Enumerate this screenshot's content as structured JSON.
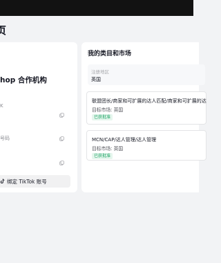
{
  "page": {
    "title": "页"
  },
  "org": {
    "name": "hop 合作机构",
    "field_label_1": "K",
    "field_label_2": "号码",
    "bind_button": "绑定 TikTok 账号"
  },
  "categories_section": {
    "title": "我的类目和市场",
    "region_label": "注册地区",
    "region_value": "英国",
    "items": [
      {
        "name": "联盟团长/商家和可扩展的达人匹配/商家和可扩展的达",
        "market": "目标市场: 英国",
        "status": "已获批准"
      },
      {
        "name": "MCN/CAP/达人管理/达人管理",
        "market": "目标市场: 英国",
        "status": "已获批准"
      }
    ]
  },
  "colors": {
    "badge_text": "#1ba363",
    "badge_bg": "#e5f6ed",
    "topbar": "#121212"
  },
  "icons": {
    "copy": "copy-icon",
    "tiktok": "tiktok-icon"
  }
}
